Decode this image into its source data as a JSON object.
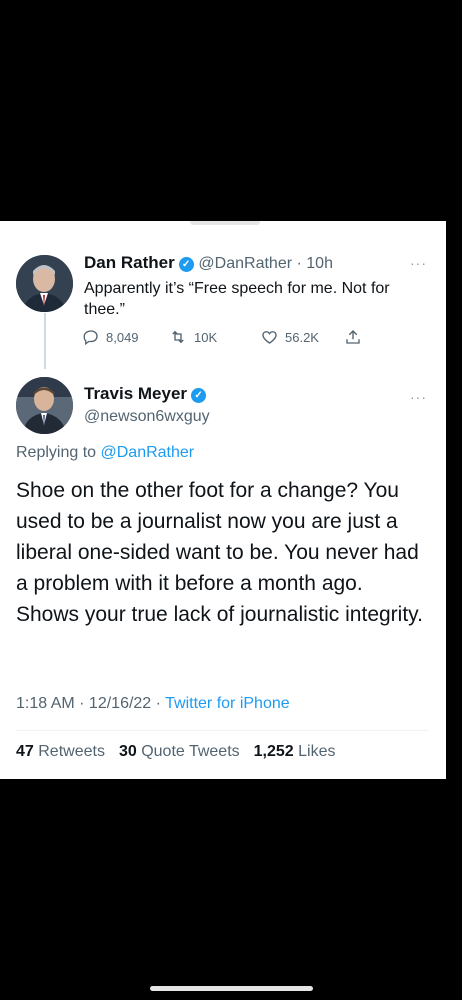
{
  "tweet_parent": {
    "name": "Dan Rather",
    "handle": "@DanRather",
    "time": "10h",
    "text": "Apparently it’s “Free speech for me. Not for thee.”",
    "replies": "8,049",
    "retweets": "10K",
    "likes": "56.2K"
  },
  "tweet_main": {
    "name": "Travis Meyer",
    "handle": "@newson6wxguy",
    "replying_prefix": "Replying to",
    "replying_handle": "@DanRather",
    "text": "Shoe on the other foot for a change? You used to be a journalist now you are just a liberal one-sided want to be. You never had a problem with it before a month ago. Shows your true lack of journalistic integrity.",
    "time": "1:18 AM",
    "date": "12/16/22",
    "source": "Twitter for iPhone",
    "retweets_count": "47",
    "retweets_label": "Retweets",
    "quotes_count": "30",
    "quotes_label": "Quote Tweets",
    "likes_count": "1,252",
    "likes_label": "Likes"
  },
  "colors": {
    "accent": "#1d9bf0",
    "text": "#0f1419",
    "muted": "#536471"
  },
  "icons": [
    "verified-icon",
    "more-icon",
    "reply-icon",
    "retweet-icon",
    "like-icon",
    "share-icon"
  ]
}
